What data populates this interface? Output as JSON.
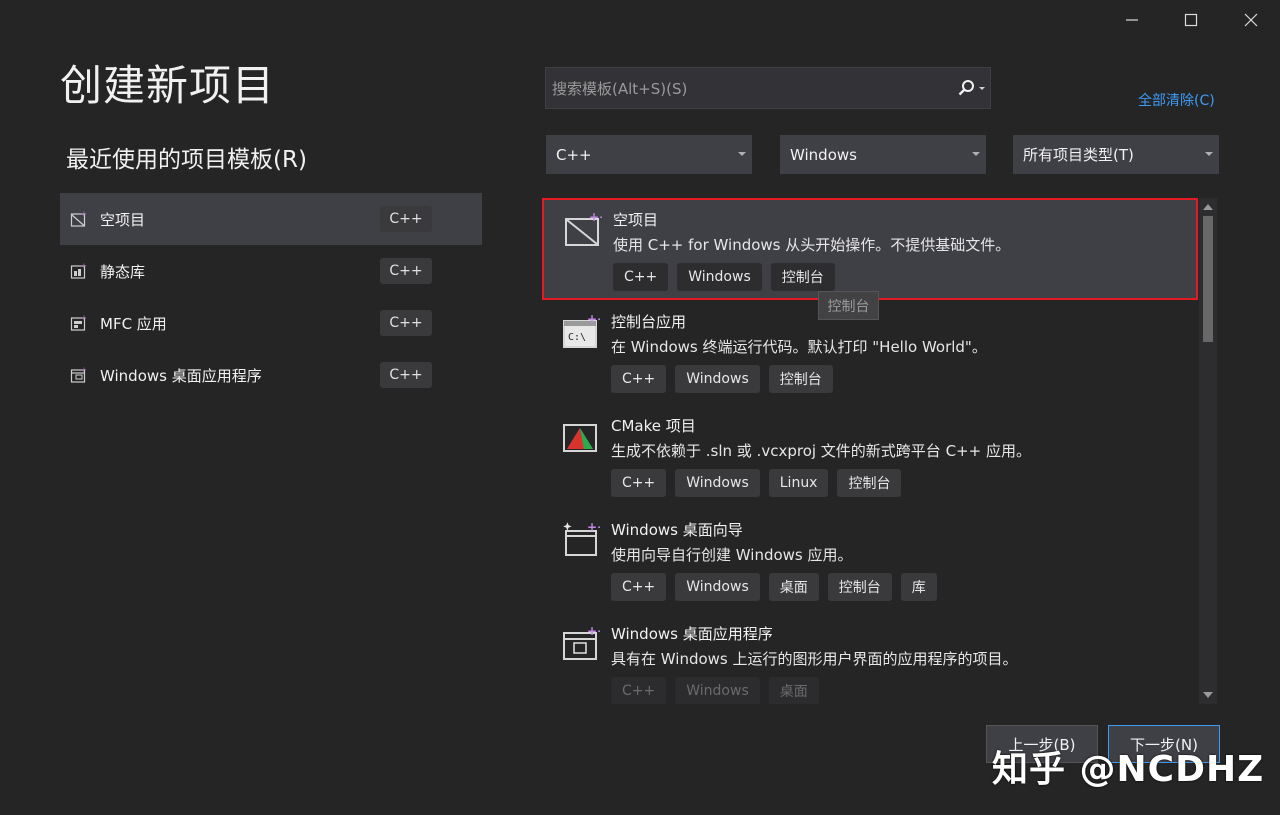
{
  "window": {
    "minimize_icon": "minimize-icon",
    "maximize_icon": "maximize-icon",
    "close_icon": "close-icon"
  },
  "page_title": "创建新项目",
  "recent": {
    "title": "最近使用的项目模板(R)",
    "items": [
      {
        "label": "空项目",
        "tag": "C++",
        "icon": "empty-project-icon",
        "selected": true
      },
      {
        "label": "静态库",
        "tag": "C++",
        "icon": "static-library-icon"
      },
      {
        "label": "MFC 应用",
        "tag": "C++",
        "icon": "mfc-app-icon"
      },
      {
        "label": "Windows 桌面应用程序",
        "tag": "C++",
        "icon": "desktop-app-icon"
      }
    ]
  },
  "search": {
    "placeholder": "搜索模板(Alt+S)(S)",
    "icon": "search-icon"
  },
  "clear_all": "全部清除(C)",
  "filters": {
    "language": "C++",
    "platform": "Windows",
    "project_type": "所有项目类型(T)"
  },
  "templates": [
    {
      "name": "空项目",
      "desc": "使用 C++ for Windows 从头开始操作。不提供基础文件。",
      "tags": [
        "C++",
        "Windows",
        "控制台"
      ],
      "icon": "empty-project-icon",
      "selected": true
    },
    {
      "name": "控制台应用",
      "desc": "在 Windows 终端运行代码。默认打印 \"Hello World\"。",
      "tags": [
        "C++",
        "Windows",
        "控制台"
      ],
      "icon": "console-app-icon"
    },
    {
      "name": "CMake 项目",
      "desc": "生成不依赖于 .sln 或 .vcxproj 文件的新式跨平台 C++ 应用。",
      "tags": [
        "C++",
        "Windows",
        "Linux",
        "控制台"
      ],
      "icon": "cmake-icon"
    },
    {
      "name": "Windows 桌面向导",
      "desc": "使用向导自行创建 Windows 应用。",
      "tags": [
        "C++",
        "Windows",
        "桌面",
        "控制台",
        "库"
      ],
      "icon": "desktop-wizard-icon"
    },
    {
      "name": "Windows 桌面应用程序",
      "desc": "具有在 Windows 上运行的图形用户界面的应用程序的项目。",
      "tags": [
        "C++",
        "Windows",
        "桌面"
      ],
      "icon": "desktop-app-icon"
    }
  ],
  "tooltip": "控制台",
  "buttons": {
    "back": "上一步(B)",
    "next": "下一步(N)"
  },
  "watermark": "知乎 @NCDHZ",
  "colors": {
    "background": "#252526",
    "selection": "#3f3f46",
    "highlight_border": "#e51b23",
    "link": "#3e9bf5"
  }
}
